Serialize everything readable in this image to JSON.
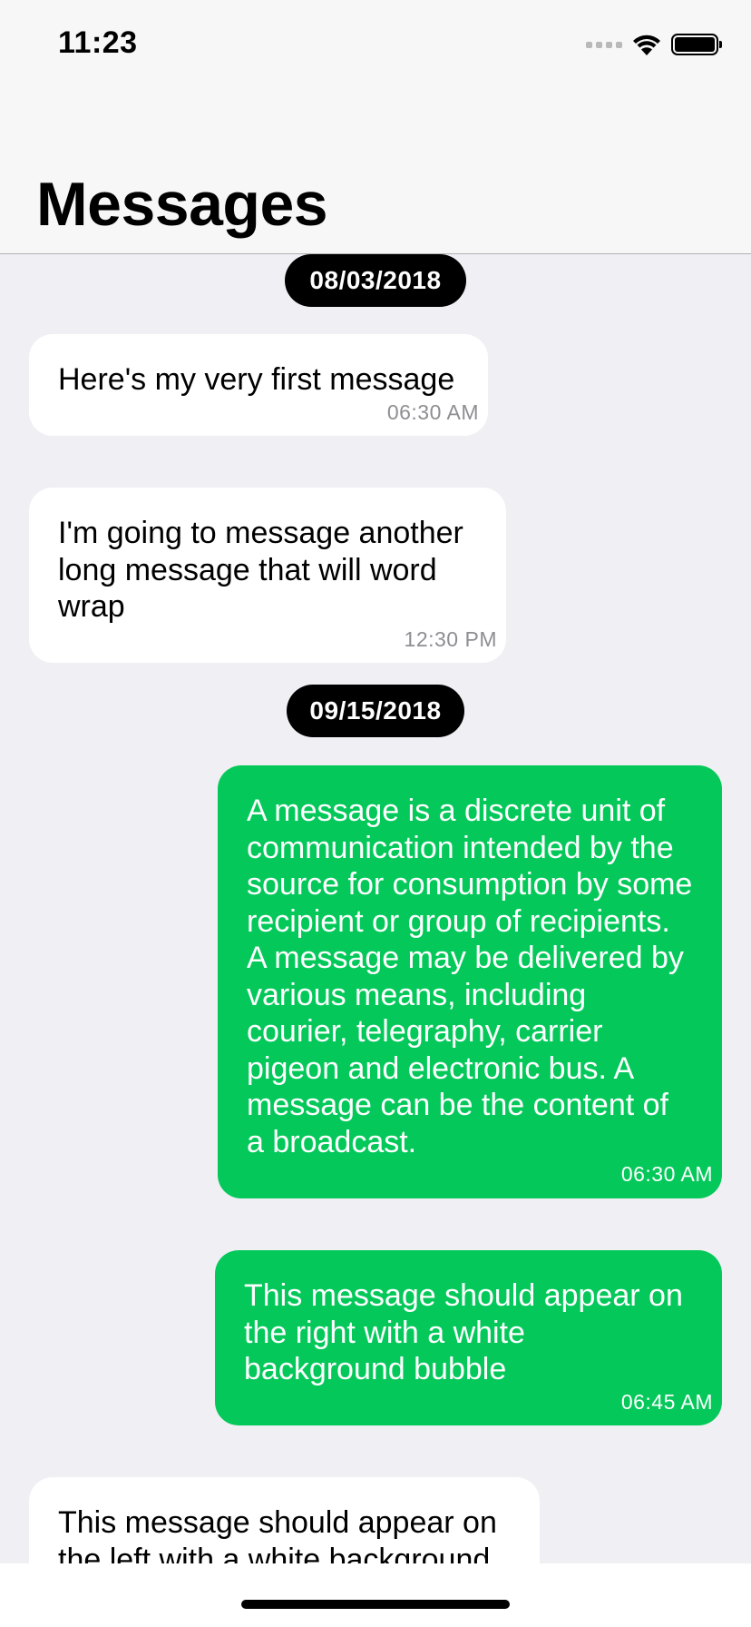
{
  "status_bar": {
    "time": "11:23"
  },
  "header": {
    "title": "Messages"
  },
  "messages": [
    {
      "date": "08/03/2018"
    },
    {
      "text": "Here's my very first message",
      "time": "06:30 AM",
      "side": "left"
    },
    {
      "text": "I'm going to message another long message that will word wrap",
      "time": "12:30 PM",
      "side": "left"
    },
    {
      "date": "09/15/2018"
    },
    {
      "text": "A message is a discrete unit of communication intended by the source for consumption by some recipient or group of recipients. A message may be delivered by various means, including courier, telegraphy, carrier pigeon and electronic bus. A message can be the content of a broadcast.",
      "time": "06:30 AM",
      "side": "right"
    },
    {
      "text": "This message should appear on the right with a white background bubble",
      "time": "06:45 AM",
      "side": "right"
    },
    {
      "text": "This message should appear on the left with a white background",
      "time": "",
      "side": "left"
    }
  ],
  "colors": {
    "outgoing_bubble": "#04c95a",
    "incoming_bubble": "#ffffff",
    "date_badge": "#000000",
    "list_background": "#efeff4"
  }
}
